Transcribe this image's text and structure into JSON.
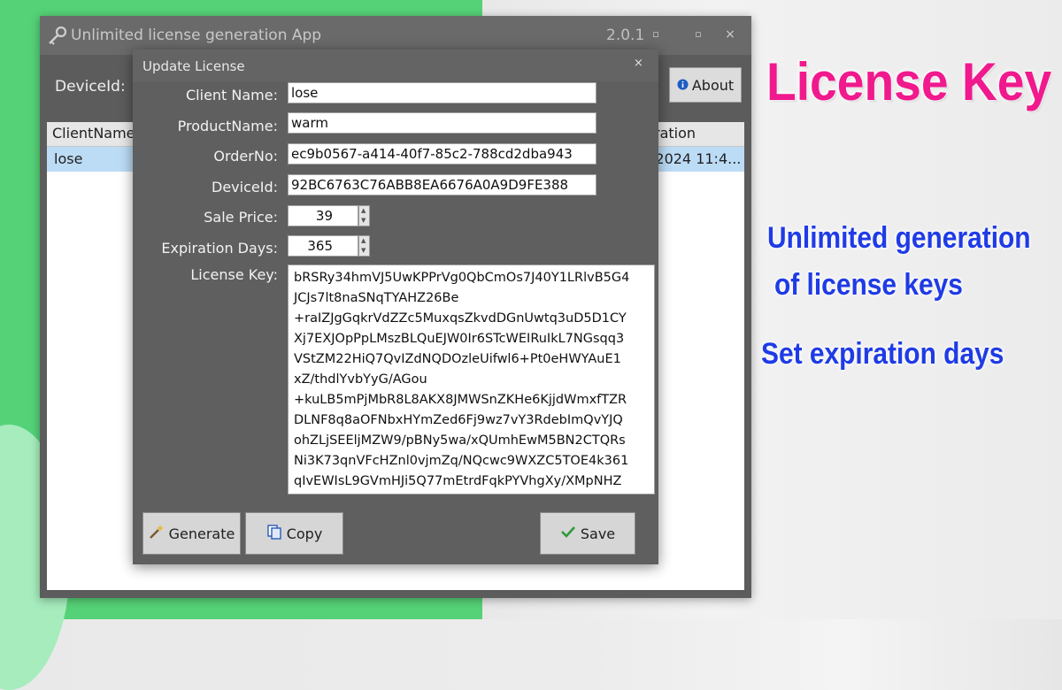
{
  "main_window": {
    "title": "Unlimited license generation App",
    "version": "2.0.1",
    "minimize_glyph": "▫",
    "maximize_glyph": "▫",
    "close_glyph": "×",
    "deviceid_label": "DeviceId:",
    "about_label": "About",
    "grid": {
      "headers": [
        "ClientName",
        "ration"
      ],
      "rows": [
        {
          "client": "lose",
          "expiration": "/2024 11:4..."
        }
      ]
    }
  },
  "dialog": {
    "title": "Update License",
    "close_glyph": "×",
    "fields": {
      "client_name_label": "Client Name:",
      "client_name": "lose",
      "product_name_label": "ProductName:",
      "product_name": "warm",
      "order_no_label": "OrderNo:",
      "order_no": "ec9b0567-a414-40f7-85c2-788cd2dba943",
      "device_id_label": "DeviceId:",
      "device_id": "92BC6763C76ABB8EA6676A0A9D9FE388",
      "sale_price_label": "Sale Price:",
      "sale_price": "39",
      "expiration_days_label": "Expiration Days:",
      "expiration_days": "365",
      "license_key_label": "License Key:"
    },
    "license_key_lines": [
      "bRSRy34hmVJ5UwKPPrVg0QbCmOs7J40Y1LRlvB5G4",
      "JCJs7lt8naSNqTYAHZ26Be",
      "+raIZJgGqkrVdZZc5MuxqsZkvdDGnUwtq3uD5D1CY",
      "Xj7EXJOpPpLMszBLQuEJW0Ir6STcWEIRuIkL7NGsqq3",
      "VStZM22HiQ7QvIZdNQDOzleUifwl6+Pt0eHWYAuE1",
      "xZ/thdlYvbYyG/AGou",
      "+kuLB5mPjMbR8L8AKX8JMWSnZKHe6KjjdWmxfTZR",
      "DLNF8q8aOFNbxHYmZed6Fj9wz7vY3RdebImQvYJQ",
      "ohZLjSEEljMZW9/pBNy5wa/xQUmhEwM5BN2CTQRs",
      "Ni3K73qnVFcHZnl0vjmZq/NQcwc9WXZC5TOE4k361",
      "qIvEWIsL9GVmHJi5Q77mEtrdFqkPYVhgXy/XMpNHZ"
    ],
    "buttons": {
      "generate": "Generate",
      "copy": "Copy",
      "save": "Save"
    }
  },
  "promo": {
    "title": "License Key",
    "line1": "Unlimited generation",
    "line2": "of license keys",
    "line3": "Set expiration days"
  },
  "colors": {
    "promo_pink": "#f0198d",
    "promo_blue": "#1f3be6",
    "background_green": "#55d277",
    "selection_blue": "#bcdcf6"
  }
}
